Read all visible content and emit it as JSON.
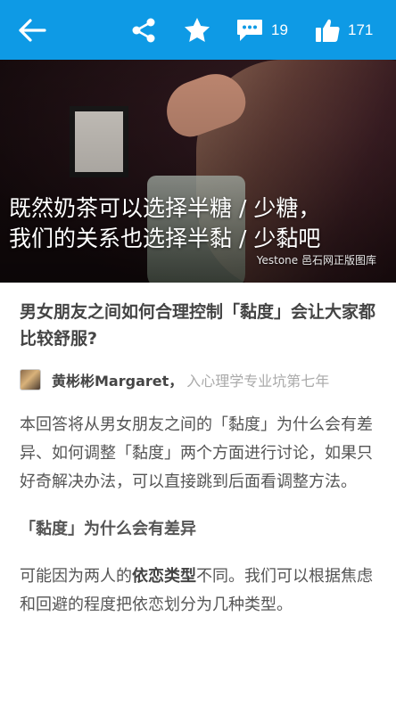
{
  "topbar": {
    "back_icon": "arrow-left-icon",
    "share_icon": "share-icon",
    "star_icon": "star-icon",
    "comment_icon": "comment-icon",
    "comment_count": "19",
    "like_icon": "thumbs-up-icon",
    "like_count": "171",
    "bg_color": "#0e9ae5"
  },
  "hero": {
    "overlay_line1": "既然奶茶可以选择半糖 / 少糖，",
    "overlay_line2": "我们的关系也选择半黏 / 少黏吧",
    "credit": "Yestone 邑石网正版图库"
  },
  "question": {
    "title": "男女朋友之间如何合理控制「黏度」会让大家都比较舒服?"
  },
  "author": {
    "name": "黄彬彬Margaret，",
    "bio": "入心理学专业坑第七年"
  },
  "body": {
    "p1": "本回答将从男女朋友之间的「黏度」为什么会有差异、如何调整「黏度」两个方面进行讨论，如果只好奇解决办法，可以直接跳到后面看调整方法。",
    "heading1": "「黏度」为什么会有差异",
    "p2_pre": "可能因为两人的",
    "p2_bold": "依恋类型",
    "p2_post": "不同。我们可以根据焦虑和回避的程度把依恋划分为几种类型。"
  }
}
